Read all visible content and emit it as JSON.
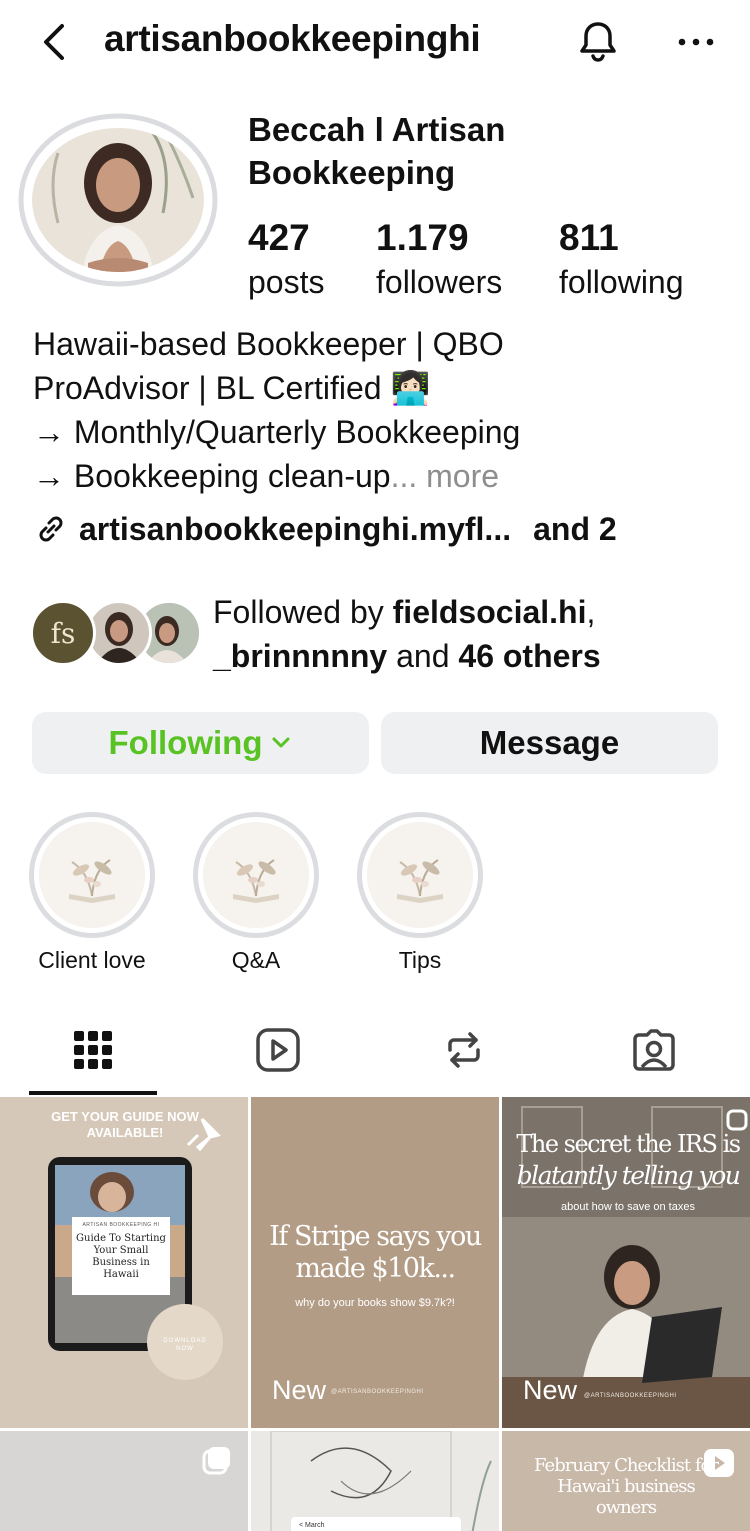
{
  "header": {
    "username": "artisanbookkeepinghi",
    "back_icon": "chevron-left-icon",
    "bell_icon": "bell-icon",
    "more_icon": "more-horizontal-icon"
  },
  "profile": {
    "display_name": "Beccah l Artisan Bookkeeping",
    "stats": [
      {
        "value": "427",
        "label": "posts"
      },
      {
        "value": "1.179",
        "label": "followers"
      },
      {
        "value": "811",
        "label": "following"
      }
    ],
    "bio": {
      "line1": "Hawaii-based Bookkeeper | QBO",
      "line2": "ProAdvisor | BL Certified 👩🏻‍💻",
      "line3": "→ Monthly/Quarterly Bookkeeping",
      "line4": "→ Bookkeeping clean-up",
      "more": "... more"
    },
    "link": {
      "text": "artisanbookkeepinghi.myfl...",
      "extra": "and 2"
    }
  },
  "followed_by": {
    "prefix": "Followed by ",
    "user1": "fieldsocial.hi",
    "sep": ",",
    "user2": "_brinnnnny",
    "mid": " and ",
    "others": "46 others",
    "face1_initials": "fs"
  },
  "actions": {
    "following": "Following",
    "message": "Message"
  },
  "highlights": [
    {
      "label": "Client love"
    },
    {
      "label": "Q&A"
    },
    {
      "label": "Tips"
    }
  ],
  "tabs": [
    "grid-icon",
    "reels-icon",
    "reposts-icon",
    "tagged-icon"
  ],
  "posts": {
    "p1": {
      "banner": "GET YOUR GUIDE NOW AVAILABLE!",
      "brand": "ARTISAN BOOKKEEPING HI",
      "guide": "Guide To Starting Your Small Business in Hawaii",
      "cta": "DOWNLOAD NOW"
    },
    "p2": {
      "title": "If Stripe says you made $10k...",
      "sub": "why do your books show $9.7k?!",
      "badge": "New",
      "handle": "@ARTISANBOOKKEEPINGHI"
    },
    "p3": {
      "title1": "The secret the IRS is",
      "title2": "blatantly telling you",
      "sub": "about how to save on taxes",
      "badge": "New",
      "handle": "@ARTISANBOOKKEEPINGHI"
    },
    "p6": {
      "title": "February Checklist for Hawai'i business owners"
    },
    "p5": {
      "nav": "< March"
    }
  },
  "colors": {
    "accent_green": "#58c322",
    "button_bg": "#eff0f2",
    "muted": "#8e8e8e"
  }
}
